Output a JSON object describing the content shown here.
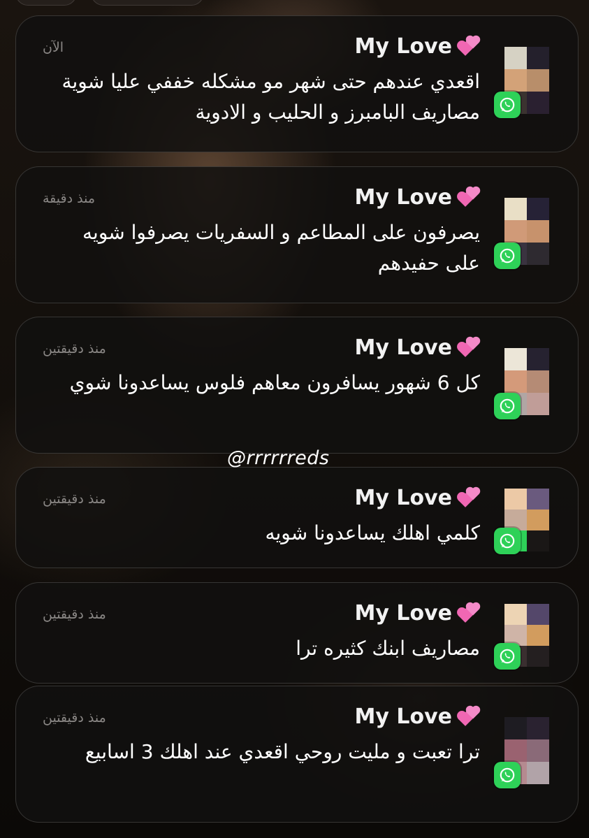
{
  "notifications": [
    {
      "sender": "My Love",
      "time": "الآن",
      "message": "اقعدي عندهم حتى شهر مو مشكله خففي عليا شوية مصاريف البامبرز و الحليب و الادوية",
      "avatar_colors": [
        "#d6d2c4",
        "#24202c",
        "#d3a278",
        "#b88e6a",
        "#3b3330",
        "#2a2030"
      ]
    },
    {
      "sender": "My Love",
      "time": "منذ دقيقة",
      "message": "يصرفون على المطاعم و السفريات يصرفوا شويه على حفيدهم",
      "avatar_colors": [
        "#e9dfc6",
        "#262236",
        "#d09a78",
        "#c7926c",
        "#3a3340",
        "#2e2a30"
      ]
    },
    {
      "sender": "My Love",
      "time": "منذ دقيقتين",
      "message": "كل 6 شهور يسافرون معاهم فلوس يساعدونا شوي",
      "avatar_colors": [
        "#ece6d8",
        "#262230",
        "#d49a7a",
        "#b58b75",
        "#b0a6a4",
        "#c09d98"
      ]
    },
    {
      "sender": "My Love",
      "time": "منذ دقيقتين",
      "message": "كلمي اهلك يساعدونا شويه",
      "avatar_colors": [
        "#ecc9a6",
        "#6a5a7e",
        "#c6ab9a",
        "#d29c5e",
        "#2ed158",
        "#1a1716"
      ]
    },
    {
      "sender": "My Love",
      "time": "منذ دقيقتين",
      "message": "مصاريف ابنك كثيره ترا",
      "avatar_colors": [
        "#edd4b4",
        "#54476a",
        "#cfb4a7",
        "#d29c5e",
        "#3a2f30",
        "#241f20"
      ]
    },
    {
      "sender": "My Love",
      "time": "منذ دقيقتين",
      "message": "ترا تعبت و مليت روحي اقعدي عند اهلك 3 اسابيع",
      "avatar_colors": [
        "#1e1c22",
        "#2a2230",
        "#9a6270",
        "#8a6a78",
        "#b58a90",
        "#b1a3a8"
      ]
    }
  ],
  "watermark": "@rrrrrreds",
  "icons": {
    "app": "whatsapp-icon",
    "emoji": "two-hearts-icon"
  }
}
